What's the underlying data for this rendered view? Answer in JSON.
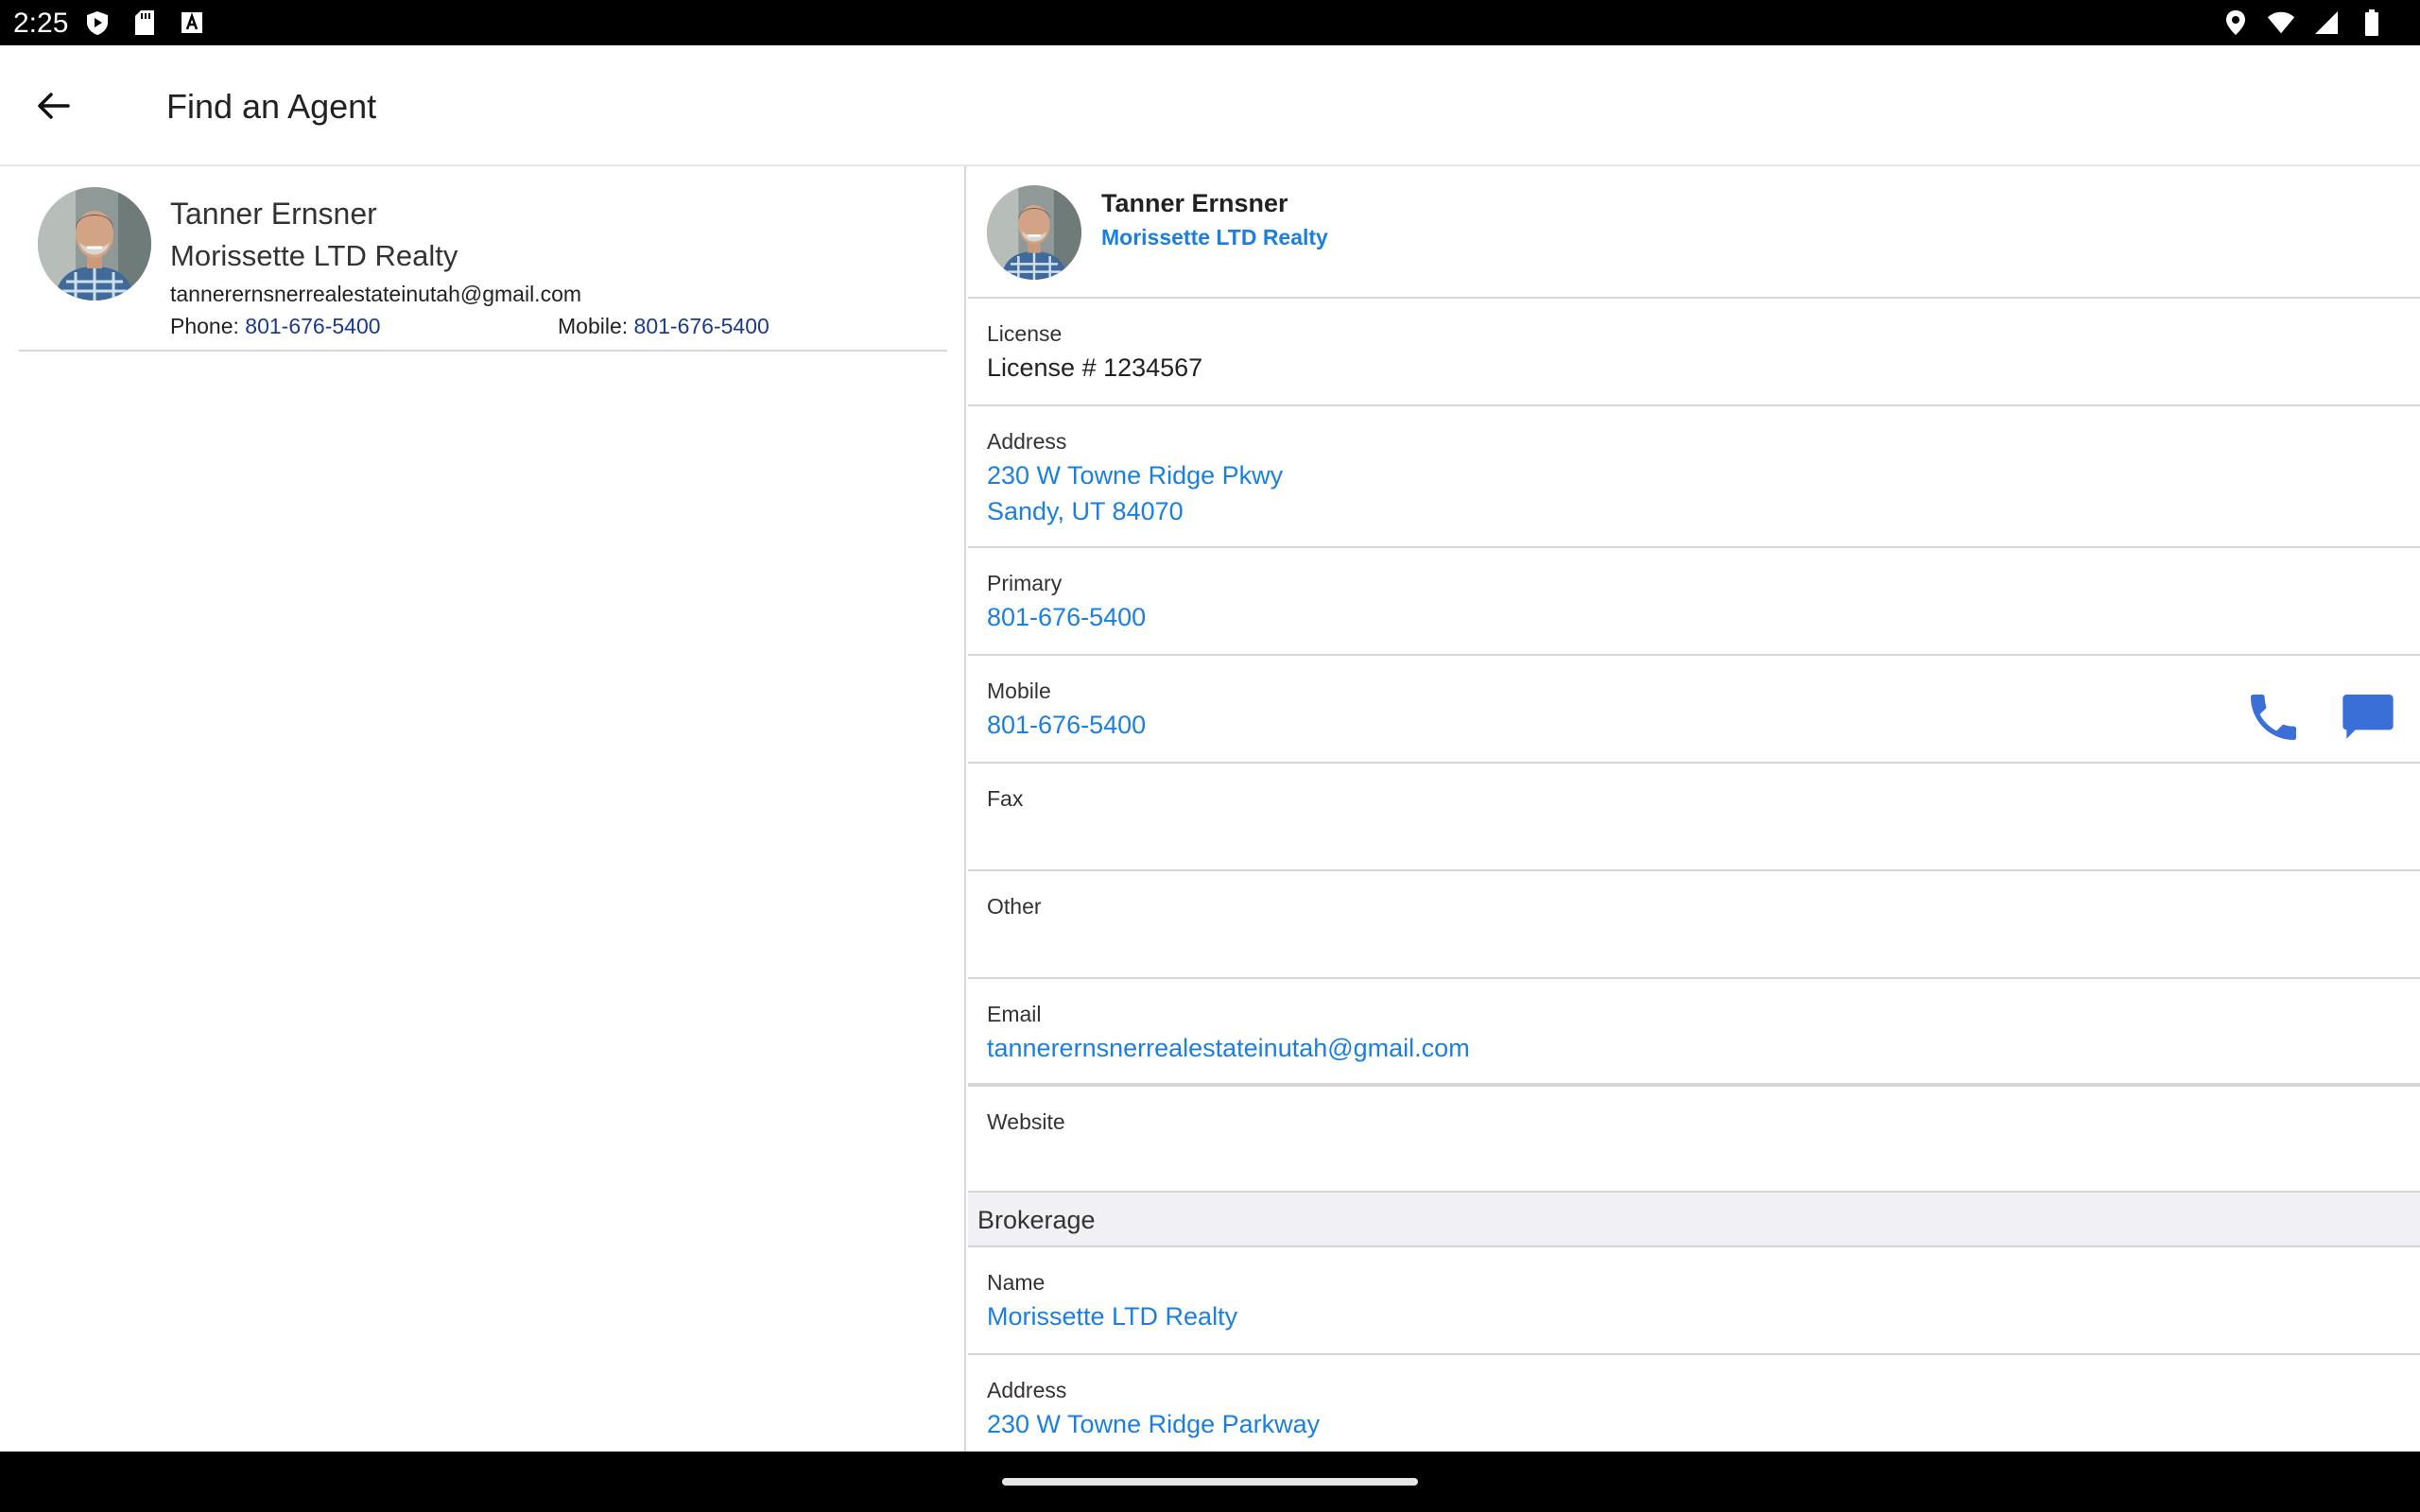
{
  "status_bar": {
    "time": "2:25",
    "left_icons": [
      "play-protect-icon",
      "sd-card-icon",
      "font-a-icon"
    ],
    "right_icons": [
      "location-icon",
      "wifi-icon",
      "cell-signal-icon",
      "battery-icon"
    ]
  },
  "app_bar": {
    "title": "Find an Agent",
    "back_icon": "arrow-left-icon"
  },
  "agent_list": [
    {
      "name": "Tanner Ernsner",
      "company": "Morissette LTD Realty",
      "email": "tannerernsnerrealestateinutah@gmail.com",
      "phone_label": "Phone: ",
      "phone": "801-676-5400",
      "mobile_label": "Mobile: ",
      "mobile": "801-676-5400"
    }
  ],
  "detail": {
    "name": "Tanner Ernsner",
    "company": "Morissette LTD Realty",
    "fields": {
      "license": {
        "label": "License",
        "value": "License # 1234567"
      },
      "address": {
        "label": "Address",
        "line1": "230 W Towne Ridge Pkwy",
        "line2": "Sandy, UT 84070"
      },
      "primary": {
        "label": "Primary",
        "value": "801-676-5400"
      },
      "mobile": {
        "label": "Mobile",
        "value": "801-676-5400"
      },
      "fax": {
        "label": "Fax",
        "value": ""
      },
      "other": {
        "label": "Other",
        "value": ""
      },
      "email": {
        "label": "Email",
        "value": "tannerernsnerrealestateinutah@gmail.com"
      },
      "website": {
        "label": "Website",
        "value": ""
      }
    },
    "brokerage": {
      "section_title": "Brokerage",
      "name": {
        "label": "Name",
        "value": "Morissette LTD Realty"
      },
      "address": {
        "label": "Address",
        "line1": "230 W Towne Ridge Parkway"
      }
    },
    "action_icons": [
      "phone-icon",
      "message-icon"
    ]
  },
  "colors": {
    "link": "#1a7fe0",
    "link_dark": "#1a3a8a",
    "icon_blue": "#3b6fd8",
    "section_bg": "#f1f1f5"
  }
}
